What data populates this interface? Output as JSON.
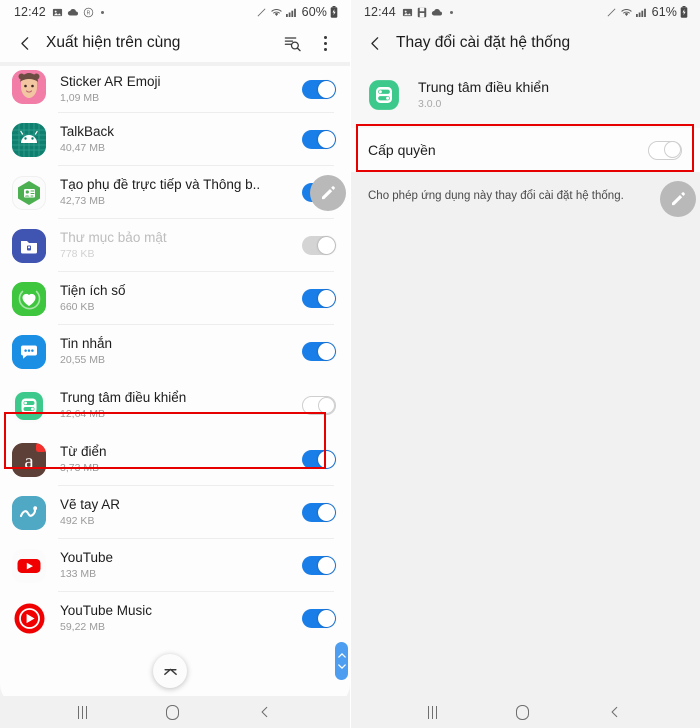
{
  "left": {
    "status": {
      "time": "12:42",
      "icons": [
        "image-icon",
        "cloud-icon",
        "registered-icon",
        "dot-icon"
      ],
      "right_icons": [
        "pen-icon",
        "wifi-icon",
        "signal-icon"
      ],
      "battery": "60%"
    },
    "appbar": {
      "back": "back-chevron-icon",
      "title": "Xuất hiện trên cùng",
      "search": "search-list-icon",
      "menu": "more-options-icon"
    },
    "apps": [
      {
        "name": "Sticker AR Emoji",
        "size": "1,09 MB",
        "toggle": "on",
        "icon": "sticker-ar-emoji-icon",
        "dim": false
      },
      {
        "name": "TalkBack",
        "size": "40,47 MB",
        "toggle": "on",
        "icon": "talkback-icon",
        "dim": false
      },
      {
        "name": "Tạo phụ đề trực tiếp và Thông b..",
        "size": "42,73 MB",
        "toggle": "on",
        "icon": "live-caption-icon",
        "dim": false
      },
      {
        "name": "Thư mục bảo mật",
        "size": "778 KB",
        "toggle": "off",
        "icon": "secure-folder-icon",
        "dim": true
      },
      {
        "name": "Tiện ích số",
        "size": "660 KB",
        "toggle": "on",
        "icon": "digital-wellbeing-icon",
        "dim": false
      },
      {
        "name": "Tin nhắn",
        "size": "20,55 MB",
        "toggle": "on",
        "icon": "messages-icon",
        "dim": false
      },
      {
        "name": "Trung tâm điều khiển",
        "size": "12,64 MB",
        "toggle": "offw",
        "icon": "control-center-icon",
        "dim": false
      },
      {
        "name": "Từ điển",
        "size": "3,73 MB",
        "toggle": "on",
        "icon": "dictionary-icon",
        "dim": false
      },
      {
        "name": "Vẽ tay AR",
        "size": "492 KB",
        "toggle": "on",
        "icon": "ar-doodle-icon",
        "dim": false
      },
      {
        "name": "YouTube",
        "size": "133 MB",
        "toggle": "on",
        "icon": "youtube-icon",
        "dim": false
      },
      {
        "name": "YouTube Music",
        "size": "59,22 MB",
        "toggle": "on",
        "icon": "youtube-music-icon",
        "dim": false
      }
    ],
    "highlight_row_index": 6,
    "fab": "edit-pencil-icon",
    "scroll_top": "scroll-to-top-icon",
    "nav": [
      "recents-icon",
      "home-icon",
      "back-icon"
    ]
  },
  "right": {
    "status": {
      "time": "12:44",
      "icons": [
        "image-icon",
        "save-icon",
        "cloud-icon",
        "dot-icon"
      ],
      "right_icons": [
        "pen-icon",
        "wifi-icon",
        "signal-icon"
      ],
      "battery": "61%"
    },
    "appbar": {
      "back": "back-chevron-icon",
      "title": "Thay đổi cài đặt hệ thống"
    },
    "app": {
      "name": "Trung tâm điều khiển",
      "version": "3.0.0",
      "icon": "control-center-icon"
    },
    "permission": {
      "label": "Cấp quyền",
      "toggle": "offw"
    },
    "description": "Cho phép ứng dụng này thay đổi cài đặt hệ thống.",
    "fab": "edit-pencil-icon",
    "nav": [
      "recents-icon",
      "home-icon",
      "back-icon"
    ]
  },
  "colors": {
    "accent_blue": "#1a7ee8",
    "highlight_red": "#e60000",
    "control_center_green": "#3cc98b",
    "page_bg": "#f1f1f1"
  }
}
